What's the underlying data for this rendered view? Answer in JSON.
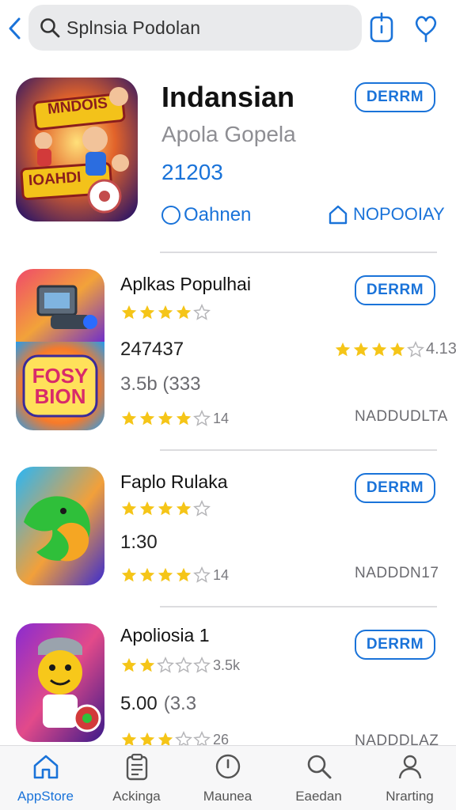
{
  "header": {
    "search_text": "Splnsia Podolan"
  },
  "featured": {
    "title": "Indansian",
    "subtitle": "Apola Gopela",
    "number": "21203",
    "meta_left": "Oahnen",
    "meta_right": "NOPOOIAY",
    "button": "DERRM",
    "art_text_top": "MNDOIS",
    "art_text_bottom": "IOAHDI"
  },
  "list": [
    {
      "name": "Aplkas Populhai",
      "rating": 4,
      "button": "DERRM",
      "art": "camera"
    },
    {
      "value": "247437",
      "right_rating": 4,
      "right_count": "4.133",
      "sub": "3.5b (333",
      "rating": 4,
      "count": "14",
      "right_label": "NADDUDLTA",
      "art": "text-logo",
      "art_text": "FOSY BION"
    },
    {
      "name": "Faplo Rulaka",
      "rating": 4,
      "button": "DERRM",
      "value": "1:30",
      "rating2": 4,
      "count2": "14",
      "right_label": "NADDDN17",
      "art": "green-blob"
    },
    {
      "name": "Apoliosia 1",
      "rating": 2,
      "count": "3.5k",
      "button": "DERRM",
      "value": "5.00",
      "value_suffix": "(3.3",
      "rating2": 3,
      "count2": "26",
      "right_label": "NADDDLAZ",
      "art": "character"
    }
  ],
  "tabs": [
    {
      "label": "AppStore",
      "icon": "home-icon",
      "active": true
    },
    {
      "label": "Ackinga",
      "icon": "clipboard-icon",
      "active": false
    },
    {
      "label": "Maunea",
      "icon": "clock-icon",
      "active": false
    },
    {
      "label": "Eaedan",
      "icon": "search-icon",
      "active": false
    },
    {
      "label": "Nrarting",
      "icon": "person-icon",
      "active": false
    }
  ],
  "colors": {
    "accent": "#1a73d9",
    "star": "#f5c518",
    "search_bg": "#e9eaec"
  }
}
